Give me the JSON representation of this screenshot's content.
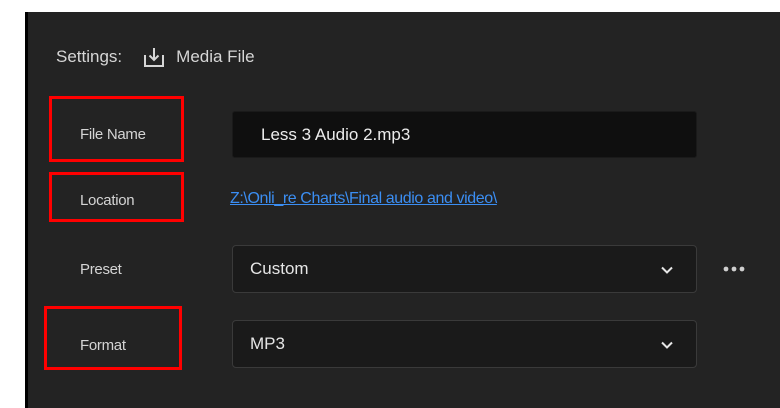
{
  "settings": {
    "label": "Settings:",
    "icon": "export-tray-icon",
    "target": "Media File"
  },
  "fields": {
    "file_name": {
      "label": "File Name",
      "value": "Less 3 Audio 2.mp3"
    },
    "location": {
      "label": "Location",
      "value": "Z:\\Onli_re Charts\\Final audio and video\\"
    },
    "preset": {
      "label": "Preset",
      "value": "Custom",
      "more_icon": "more-ellipsis-icon"
    },
    "format": {
      "label": "Format",
      "value": "MP3"
    }
  },
  "colors": {
    "panel_bg": "#232323",
    "highlight": "#ff0000",
    "link": "#3b8ef3"
  }
}
